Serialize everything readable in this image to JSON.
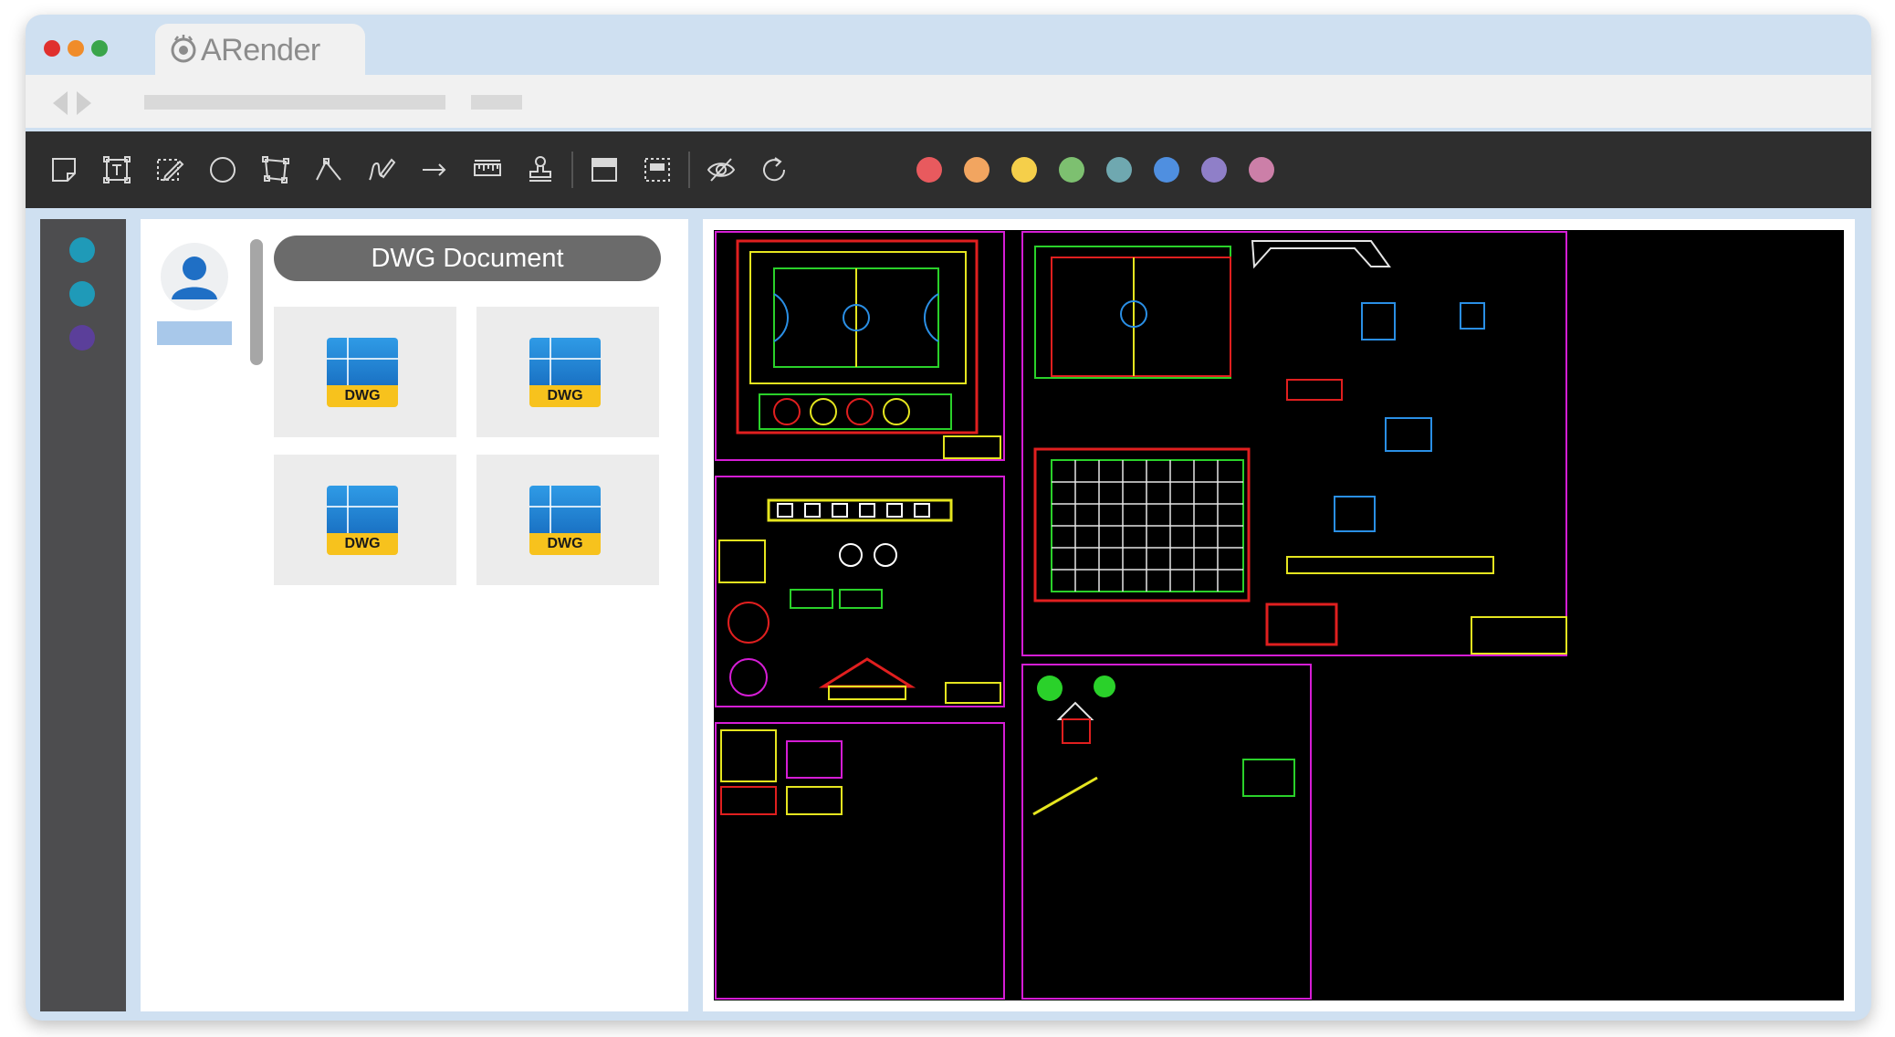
{
  "app": {
    "tab_title": "ARender",
    "window_buttons": [
      {
        "name": "close",
        "color": "#e0302e"
      },
      {
        "name": "minimize",
        "color": "#f08c2a"
      },
      {
        "name": "maximize",
        "color": "#3aa54b"
      }
    ]
  },
  "toolbar": {
    "tools": [
      "sticky-note-icon",
      "text-box-icon",
      "freehand-highlight-icon",
      "circle-icon",
      "polygon-icon",
      "polyline-icon",
      "freehand-pen-icon",
      "arrow-icon",
      "ruler-icon",
      "stamp-icon",
      "redact-area-icon",
      "redact-select-icon",
      "hide-annotations-icon",
      "rotate-icon"
    ],
    "colors": [
      "#e85a5e",
      "#f2a560",
      "#f5cf4a",
      "#7dc070",
      "#6fa8b0",
      "#4f8fe0",
      "#8f7fc8",
      "#cc7fa8"
    ]
  },
  "left_strip": {
    "dots": [
      "#1f9ab8",
      "#1f9ab8",
      "#5b3f9a"
    ]
  },
  "documents": {
    "header": "DWG Document",
    "files": [
      {
        "type": "DWG"
      },
      {
        "type": "DWG"
      },
      {
        "type": "DWG"
      },
      {
        "type": "DWG"
      }
    ]
  }
}
